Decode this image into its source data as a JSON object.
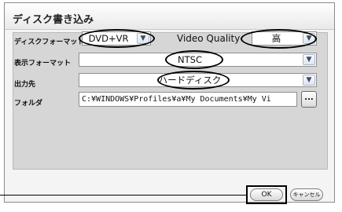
{
  "dialog": {
    "title": "ディスク書き込み",
    "disc_format": {
      "label": "ディスクフォーマット",
      "value": "DVD+VR"
    },
    "video_quality": {
      "label": "Video Quality",
      "value": "高"
    },
    "display_format": {
      "label": "表示フォーマット",
      "value": "NTSC"
    },
    "output_destination": {
      "label": "出力先",
      "value": "ハードディスク"
    },
    "folder": {
      "label": "フォルダ",
      "value": "C:¥WINDOWS¥Profiles¥a¥My Documents¥My Vi",
      "browse_label": "..."
    },
    "buttons": {
      "ok": "OK",
      "cancel": "キャンセル"
    }
  }
}
